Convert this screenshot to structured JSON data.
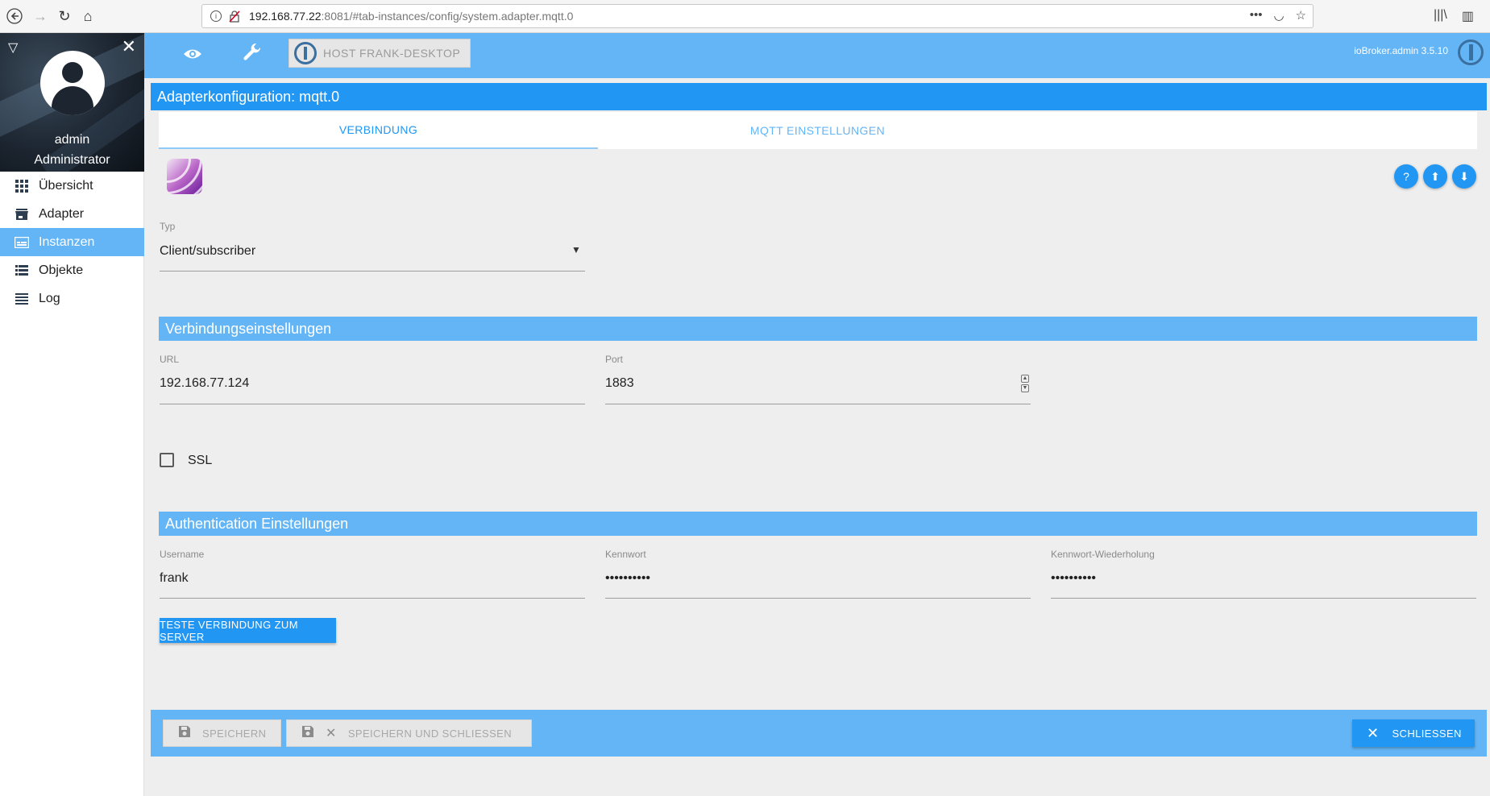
{
  "browser": {
    "url_host": "192.168.77.22",
    "url_rest": ":8081/#tab-instances/config/system.adapter.mqtt.0"
  },
  "sidebar": {
    "user_name": "admin",
    "user_role": "Administrator",
    "items": [
      {
        "label": "Übersicht",
        "icon": "grid-icon"
      },
      {
        "label": "Adapter",
        "icon": "store-icon"
      },
      {
        "label": "Instanzen",
        "icon": "instances-icon",
        "active": true
      },
      {
        "label": "Objekte",
        "icon": "list-icon"
      },
      {
        "label": "Log",
        "icon": "log-icon"
      }
    ]
  },
  "header": {
    "host_label": "HOST FRANK-DESKTOP",
    "version": "ioBroker.admin 3.5.10"
  },
  "page": {
    "title": "Adapterkonfiguration: mqtt.0",
    "tabs": [
      "VERBINDUNG",
      "MQTT EINSTELLUNGEN"
    ]
  },
  "form": {
    "typ_label": "Typ",
    "typ_value": "Client/subscriber",
    "section_connection": "Verbindungseinstellungen",
    "url_label": "URL",
    "url_value": "192.168.77.124",
    "port_label": "Port",
    "port_value": "1883",
    "ssl_label": "SSL",
    "section_auth": "Authentication Einstellungen",
    "username_label": "Username",
    "username_value": "frank",
    "password_label": "Kennwort",
    "password_value": "••••••••••",
    "password_repeat_label": "Kennwort-Wiederholung",
    "password_repeat_value": "••••••••••",
    "test_button": "TESTE VERBINDUNG ZUM SERVER"
  },
  "footer": {
    "save": "SPEICHERN",
    "save_close": "SPEICHERN UND SCHLIESSEN",
    "close": "SCHLIESSEN"
  },
  "colors": {
    "primary": "#2196f3",
    "light_primary": "#64b5f6",
    "background": "#eeeeee"
  }
}
